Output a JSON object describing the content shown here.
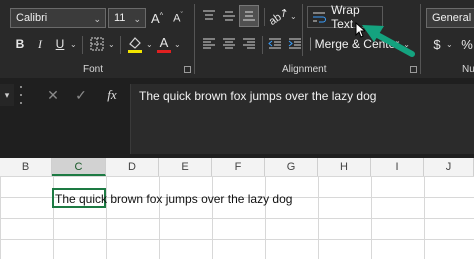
{
  "font_group": {
    "font_name": "Calibri",
    "font_size": "11",
    "label": "Font",
    "bold": "B",
    "italic": "I",
    "underline": "U",
    "font_color_letter": "A"
  },
  "alignment_group": {
    "wrap_text": "Wrap Text",
    "merge_center": "Merge & Center",
    "label": "Alignment"
  },
  "number_group": {
    "format": "General",
    "currency_symbol": "$",
    "label": "Nu"
  },
  "formula_bar": {
    "fx": "fx",
    "content": "The quick brown fox jumps over the lazy dog"
  },
  "columns": [
    "B",
    "C",
    "D",
    "E",
    "F",
    "G",
    "H",
    "I",
    "J"
  ],
  "selected_column": "C",
  "active_cell": {
    "text": "The quick brown fox jumps over the lazy dog"
  },
  "colors": {
    "ribbon_bg": "#292929",
    "accent_green": "#1d7a43",
    "arrow_teal": "#14a37f"
  }
}
